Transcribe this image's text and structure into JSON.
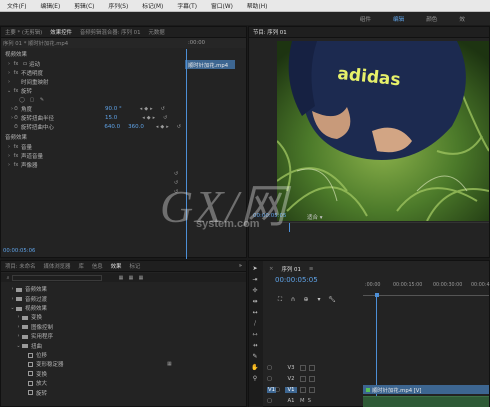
{
  "menu": [
    "文件(F)",
    "编辑(E)",
    "剪辑(C)",
    "序列(S)",
    "标记(M)",
    "字幕(T)",
    "窗口(W)",
    "帮助(H)"
  ],
  "workspace": {
    "tabs": [
      "组件",
      "编辑",
      "颜色",
      "效"
    ],
    "active": "编辑"
  },
  "effect_controls": {
    "tabs": [
      "主要 * (无剪辑)",
      "效果控件",
      "音频剪辑混合器: 序列 01",
      "元数据"
    ],
    "active_tab": "效果控件",
    "clip_label": "序列 01 * 顺时针加花.mp4",
    "ruler_time": ":00:00",
    "clip_bar": "顺时针加花.mp4",
    "video_effects_header": "视频效果",
    "motion": "运动",
    "opacity": "不透明度",
    "time_remap": "时间重映射",
    "twirl": "旋转",
    "angle_label": "角度",
    "angle_val": "90.0 °",
    "radius_label": "旋转扭曲半径",
    "radius_val": "15.0",
    "center_label": "旋转扭曲中心",
    "center_x": "640.0",
    "center_y": "360.0",
    "audio_effects_header": "音频效果",
    "volume": "音量",
    "channel_volume": "声道音量",
    "panner": "声像器",
    "timecode": "00:00:05:06"
  },
  "program": {
    "title": "节目: 序列 01",
    "timecode": "00:00:05:05",
    "fit": "适合",
    "shirt_text": "adidas"
  },
  "watermark": {
    "main": "GX/网",
    "sub": "system.com"
  },
  "project": {
    "tabs": [
      "项目: 未命名",
      "媒体浏览器",
      "库",
      "信息",
      "效果",
      "标记"
    ],
    "active_tab": "效果",
    "items": [
      {
        "label": "音频效果",
        "kind": "folder",
        "indent": 0
      },
      {
        "label": "音频过渡",
        "kind": "folder",
        "indent": 0
      },
      {
        "label": "视频效果",
        "kind": "folder",
        "indent": 0
      },
      {
        "label": "变换",
        "kind": "folder",
        "indent": 1
      },
      {
        "label": "图像控制",
        "kind": "folder",
        "indent": 1
      },
      {
        "label": "实用程序",
        "kind": "folder",
        "indent": 1
      },
      {
        "label": "扭曲",
        "kind": "folder",
        "indent": 1
      },
      {
        "label": "位移",
        "kind": "fx",
        "indent": 2
      },
      {
        "label": "变形稳定器",
        "kind": "fx",
        "indent": 2
      },
      {
        "label": "变换",
        "kind": "fx",
        "indent": 2
      },
      {
        "label": "放大",
        "kind": "fx",
        "indent": 2
      },
      {
        "label": "旋转",
        "kind": "fx",
        "indent": 2
      }
    ]
  },
  "timeline": {
    "title": "序列 01",
    "timecode": "00:00:05:05",
    "ruler": [
      ":00:00",
      "00:00:15:00",
      "00:00:30:00",
      "00:00:4"
    ],
    "tracks": [
      "V3",
      "V2",
      "V1",
      "A1"
    ],
    "clip": "顺时针加花.mp4 [V]"
  },
  "colors": {
    "accent": "#5fa3e8",
    "playhead": "#4d8fd6",
    "clip": "#3d6691"
  }
}
